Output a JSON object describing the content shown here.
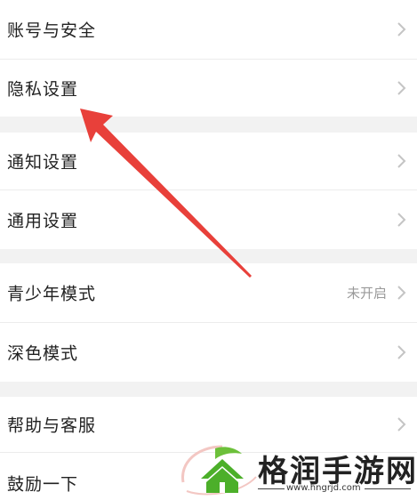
{
  "settings": {
    "items": [
      {
        "label": "账号与安全"
      },
      {
        "label": "隐私设置"
      },
      {
        "label": "通知设置"
      },
      {
        "label": "通用设置"
      },
      {
        "label": "青少年模式",
        "value": "未开启"
      },
      {
        "label": "深色模式"
      },
      {
        "label": "帮助与客服"
      },
      {
        "label": "鼓励一下"
      }
    ]
  },
  "watermark": {
    "name": "格润手游网",
    "url": "www.hngrjd.com"
  },
  "colors": {
    "arrow": "#e8403a",
    "logo_green": "#4caf2a",
    "background": "#f2f2f2",
    "row": "#ffffff"
  }
}
